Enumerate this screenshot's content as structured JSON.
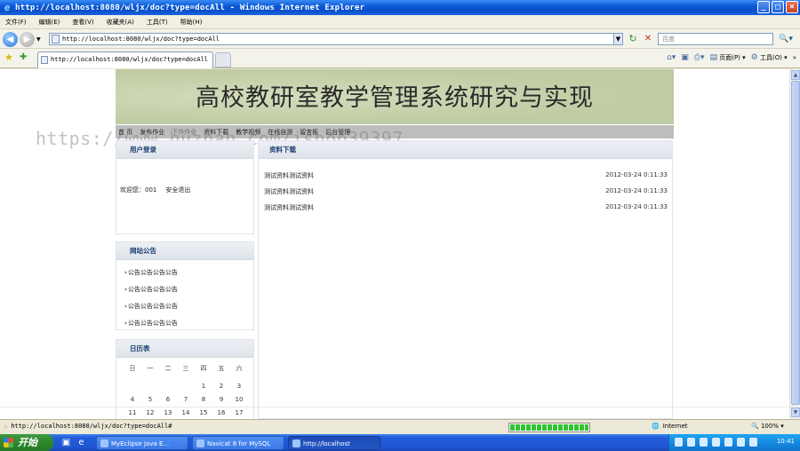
{
  "window": {
    "title": "http://localhost:8080/wljx/doc?type=docAll - Windows Internet Explorer",
    "controls": {
      "minimize": "_",
      "maximize": "□",
      "close": "×"
    }
  },
  "menu": {
    "items": [
      "文件(F)",
      "编辑(E)",
      "查看(V)",
      "收藏夹(A)",
      "工具(T)",
      "帮助(H)"
    ]
  },
  "address": {
    "url": "http://localhost:8080/wljx/doc?type=docAll",
    "search_placeholder": "百度"
  },
  "tabs": {
    "active_label": "http://localhost:8080/wljx/doc?type=docAll"
  },
  "command_bar": {
    "page_label": "页面(P)",
    "tools_label": "工具(O)"
  },
  "site": {
    "title": "高校教研室教学管理系统研究与实现",
    "nav": [
      "首 页",
      "发布作业",
      "下作作业",
      "资料下载",
      "教学视频",
      "在线自测",
      "留言板",
      "后台管理"
    ],
    "watermark": "https://www.huzhan.com/ishop39397"
  },
  "login_box": {
    "title": "用户登录",
    "welcome": "欢迎您：001",
    "logout": "安全退出"
  },
  "notice_box": {
    "title": "网站公告",
    "items": [
      "公告公告公告公告",
      "公告公告公告公告",
      "公告公告公告公告",
      "公告公告公告公告"
    ]
  },
  "calendar": {
    "title": "日历表",
    "weekdays": [
      "日",
      "一",
      "二",
      "三",
      "四",
      "五",
      "六"
    ],
    "rows": [
      [
        "",
        "",
        "",
        "",
        "1",
        "2",
        "3"
      ],
      [
        "4",
        "5",
        "6",
        "7",
        "8",
        "9",
        "10"
      ],
      [
        "11",
        "12",
        "13",
        "14",
        "15",
        "16",
        "17"
      ]
    ]
  },
  "docs": {
    "title": "资料下载",
    "rows": [
      {
        "name": "测试资料测试资料",
        "date": "2012-03-24 0:11:33"
      },
      {
        "name": "测试资料测试资料",
        "date": "2012-03-24 0:11:33"
      },
      {
        "name": "测试资料测试资料",
        "date": "2012-03-24 0:11:33"
      }
    ]
  },
  "status": {
    "text": "http://localhost:8080/wljx/doc?type=docAll#",
    "zone": "Internet",
    "zoom": "100%",
    "progress": 1.0
  },
  "taskbar": {
    "start": "开始",
    "tasks": [
      "MyEclipse Java E...",
      "Navicat 8 for MySQL",
      "http://localhost"
    ],
    "clock": "10:41"
  },
  "colors": {
    "banner": "#c8d3ae",
    "nav": "#bdbdbd",
    "box_head_text": "#1b3c6e",
    "titlebar": "#0b5ad9"
  }
}
